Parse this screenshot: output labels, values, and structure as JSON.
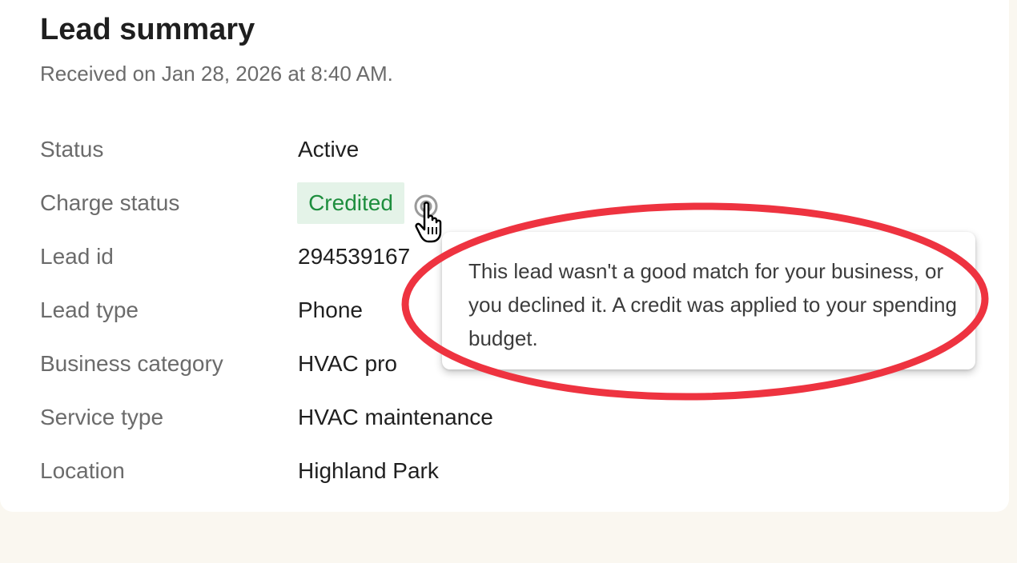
{
  "card": {
    "title": "Lead summary",
    "subtitle": "Received on Jan 28, 2026 at 8:40 AM."
  },
  "details": {
    "status": {
      "label": "Status",
      "value": "Active"
    },
    "charge_status": {
      "label": "Charge status",
      "value": "Credited"
    },
    "lead_id": {
      "label": "Lead id",
      "value": "294539167"
    },
    "lead_type": {
      "label": "Lead type",
      "value": "Phone"
    },
    "business_category": {
      "label": "Business category",
      "value": "HVAC pro"
    },
    "service_type": {
      "label": "Service type",
      "value": "HVAC maintenance"
    },
    "location": {
      "label": "Location",
      "value": "Highland Park"
    }
  },
  "tooltip": {
    "text": "This lead wasn't a good match for your business, or you declined it. A credit was applied to your spending budget."
  },
  "icons": {
    "help": "help-circle-icon",
    "cursor": "hand-pointer-icon"
  },
  "colors": {
    "page_background": "#faf7f0",
    "badge_background": "#e4f3e8",
    "badge_text": "#1e8e3e",
    "annotation_red": "#ee3340"
  }
}
